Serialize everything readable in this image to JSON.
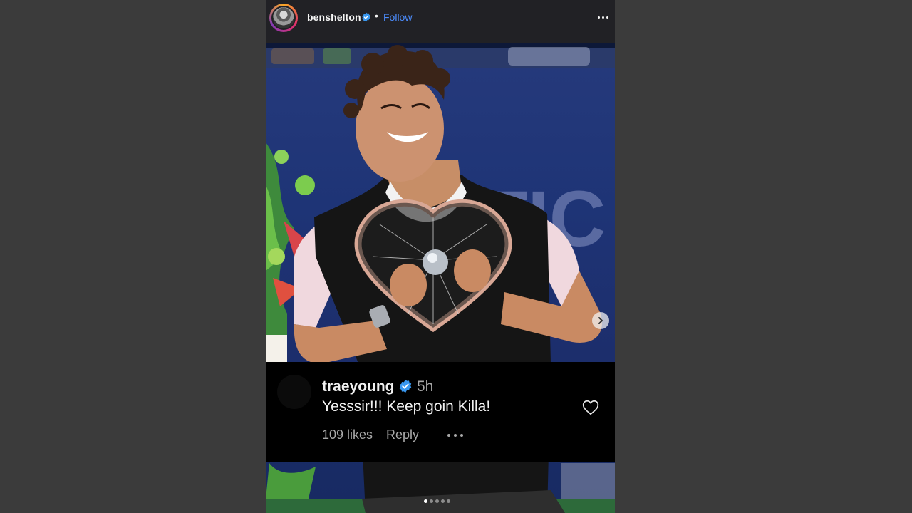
{
  "post": {
    "username": "benshelton",
    "verified": true,
    "separator": "•",
    "follow_label": "Follow",
    "more_icon": "more-horizontal-icon"
  },
  "media": {
    "description_icon": "photo",
    "carousel_count": 5,
    "carousel_active": 0,
    "next_icon": "chevron-right-icon"
  },
  "comment": {
    "username": "traeyoung",
    "verified": true,
    "time": "5h",
    "text": "Yesssir!!! Keep goin Killa!",
    "likes": "109 likes",
    "reply_label": "Reply",
    "like_icon": "heart-outline-icon",
    "more_icon": "more-horizontal-icon"
  },
  "colors": {
    "background": "#3b3b3b",
    "header_bg": "#212125",
    "follow_blue": "#4c8dff",
    "verified_blue": "#3897f0"
  }
}
